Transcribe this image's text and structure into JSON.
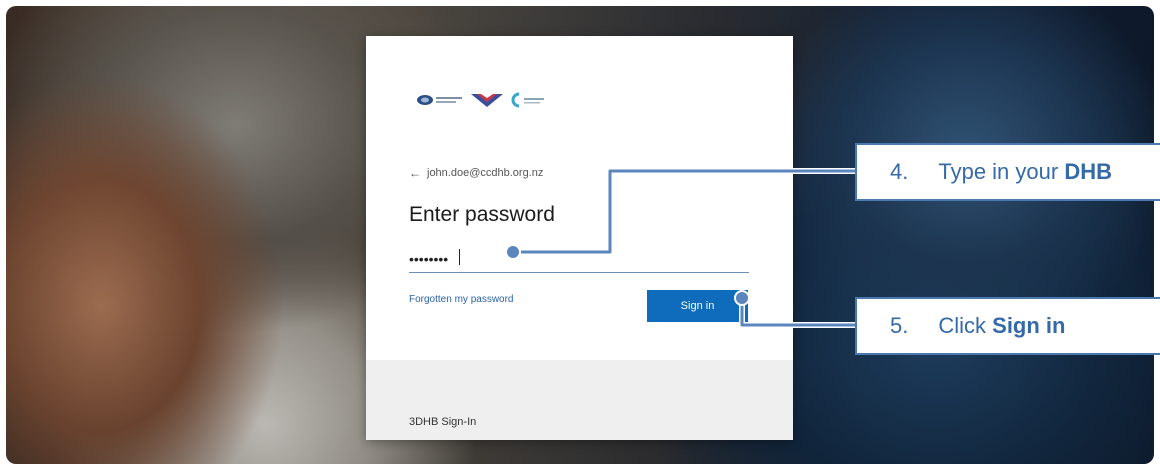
{
  "login": {
    "account": "john.doe@ccdhb.org.nz",
    "title": "Enter password",
    "password_value": "••••••••",
    "forgot_link": "Forgotten my password",
    "sign_in_button": "Sign in",
    "footer": "3DHB Sign-In"
  },
  "callouts": [
    {
      "number": "4.",
      "text_prefix": "Type in your ",
      "text_bold": "DHB"
    },
    {
      "number": "5.",
      "text_prefix": "Click ",
      "text_bold": "Sign in"
    }
  ],
  "colors": {
    "accent": "#0f6cbd",
    "callout_border": "#4a79b0",
    "callout_text": "#3569a8",
    "leader_line": "#5b86bd"
  },
  "icons": {
    "back": "left-arrow-icon",
    "logos": [
      "organization-logo-1",
      "organization-logo-2",
      "organization-logo-3"
    ]
  }
}
